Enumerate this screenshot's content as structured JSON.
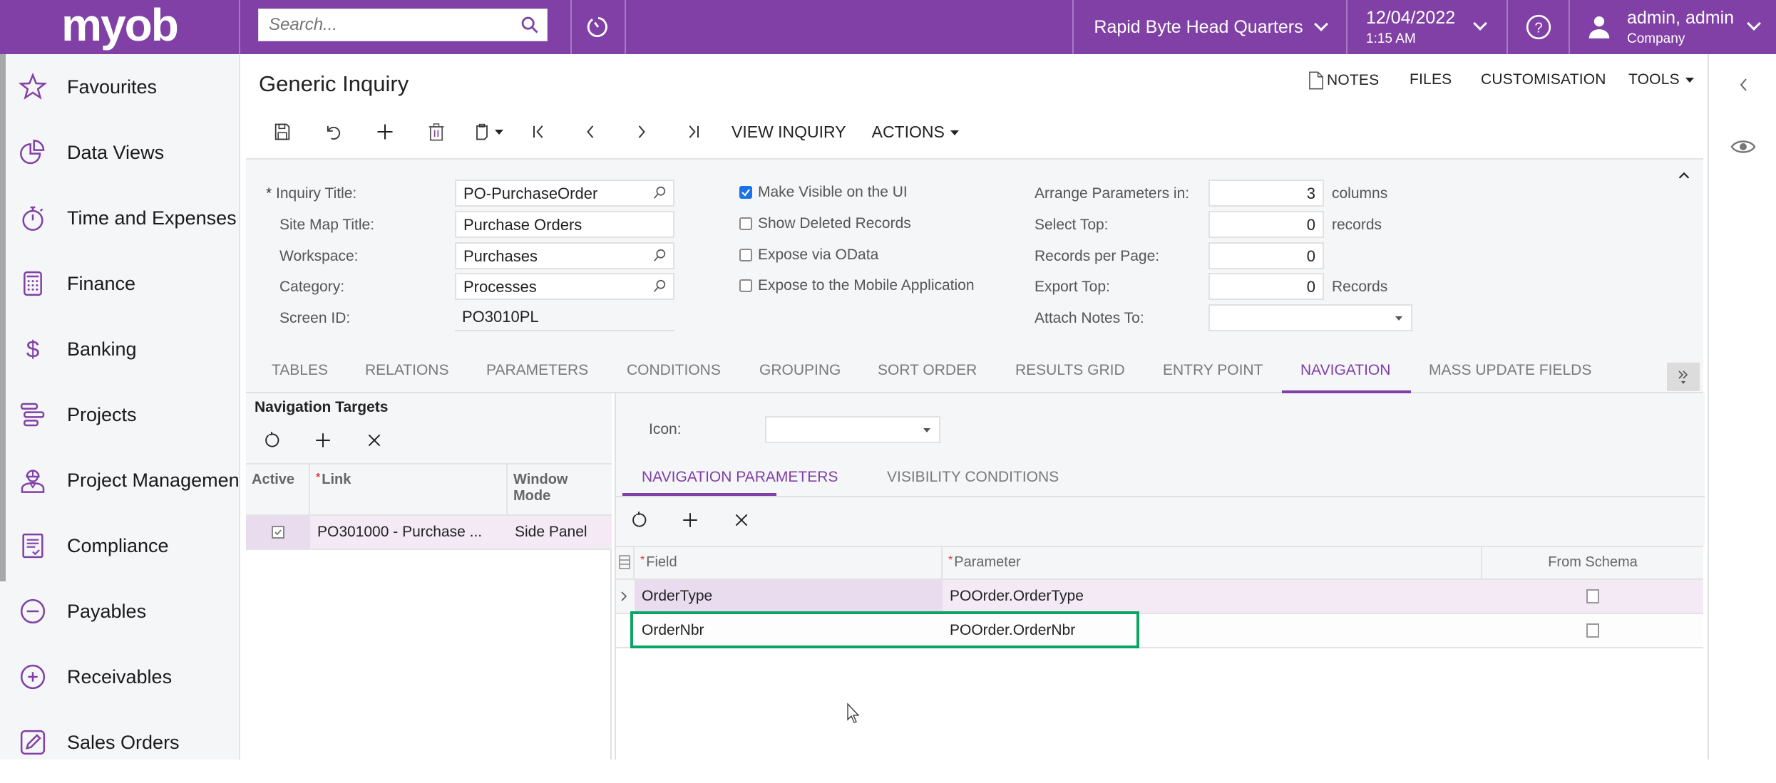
{
  "topbar": {
    "logo": "myob",
    "search_placeholder": "Search...",
    "company": "Rapid Byte Head Quarters",
    "date": "12/04/2022",
    "time": "1:15 AM",
    "user_name": "admin, admin",
    "user_company": "Company",
    "brand_color": "#8040a6"
  },
  "sidebar": {
    "items": [
      {
        "label": "Favourites",
        "icon": "star-icon"
      },
      {
        "label": "Data Views",
        "icon": "pie-chart-icon"
      },
      {
        "label": "Time and Expenses",
        "icon": "stopwatch-icon"
      },
      {
        "label": "Finance",
        "icon": "calculator-icon"
      },
      {
        "label": "Banking",
        "icon": "dollar-icon"
      },
      {
        "label": "Projects",
        "icon": "gantt-icon"
      },
      {
        "label": "Project Management",
        "icon": "worker-icon"
      },
      {
        "label": "Compliance",
        "icon": "checklist-icon"
      },
      {
        "label": "Payables",
        "icon": "minus-circle-icon"
      },
      {
        "label": "Receivables",
        "icon": "plus-circle-icon"
      },
      {
        "label": "Sales Orders",
        "icon": "pencil-icon"
      }
    ]
  },
  "header": {
    "title": "Generic Inquiry",
    "links": {
      "notes": "NOTES",
      "files": "FILES",
      "customisation": "CUSTOMISATION",
      "tools": "TOOLS"
    }
  },
  "toolbar": {
    "view_inquiry": "VIEW INQUIRY",
    "actions": "ACTIONS"
  },
  "form": {
    "inquiry_title": {
      "label": "Inquiry Title:",
      "value": "PO-PurchaseOrder",
      "required": "*"
    },
    "site_map_title": {
      "label": "Site Map Title:",
      "value": "Purchase Orders"
    },
    "workspace": {
      "label": "Workspace:",
      "value": "Purchases"
    },
    "category": {
      "label": "Category:",
      "value": "Processes"
    },
    "screen_id": {
      "label": "Screen ID:",
      "value": "PO3010PL"
    },
    "checkboxes": [
      {
        "label": "Make Visible on the UI",
        "checked": true
      },
      {
        "label": "Show Deleted Records",
        "checked": false
      },
      {
        "label": "Expose via OData",
        "checked": false
      },
      {
        "label": "Expose to the Mobile Application",
        "checked": false
      }
    ],
    "arrange_parameters": {
      "label": "Arrange Parameters in:",
      "value": "3",
      "suffix": "columns"
    },
    "select_top": {
      "label": "Select Top:",
      "value": "0",
      "suffix": "records"
    },
    "records_per_page": {
      "label": "Records per Page:",
      "value": "0"
    },
    "export_top": {
      "label": "Export Top:",
      "value": "0",
      "suffix": "Records"
    },
    "attach_notes_to": {
      "label": "Attach Notes To:",
      "value": ""
    }
  },
  "tabs": [
    {
      "label": "TABLES"
    },
    {
      "label": "RELATIONS"
    },
    {
      "label": "PARAMETERS"
    },
    {
      "label": "CONDITIONS"
    },
    {
      "label": "GROUPING"
    },
    {
      "label": "SORT ORDER"
    },
    {
      "label": "RESULTS GRID"
    },
    {
      "label": "ENTRY POINT"
    },
    {
      "label": "NAVIGATION",
      "active": true
    },
    {
      "label": "MASS UPDATE FIELDS"
    }
  ],
  "nav_targets": {
    "title": "Navigation Targets",
    "columns": {
      "active": "Active",
      "link": "Link",
      "window_mode": "Window Mode"
    },
    "rows": [
      {
        "active": true,
        "link": "PO301000 - Purchase ...",
        "window_mode": "Side Panel"
      }
    ]
  },
  "nav_detail": {
    "icon_label": "Icon:",
    "icon_value": "",
    "sub_tabs": [
      {
        "label": "NAVIGATION PARAMETERS",
        "active": true
      },
      {
        "label": "VISIBILITY CONDITIONS"
      }
    ],
    "columns": {
      "field": "Field",
      "parameter": "Parameter",
      "from_schema": "From Schema"
    },
    "rows": [
      {
        "field": "OrderType",
        "parameter": "POOrder.OrderType",
        "from_schema": false
      },
      {
        "field": "OrderNbr",
        "parameter": "POOrder.OrderNbr",
        "from_schema": false
      }
    ]
  }
}
